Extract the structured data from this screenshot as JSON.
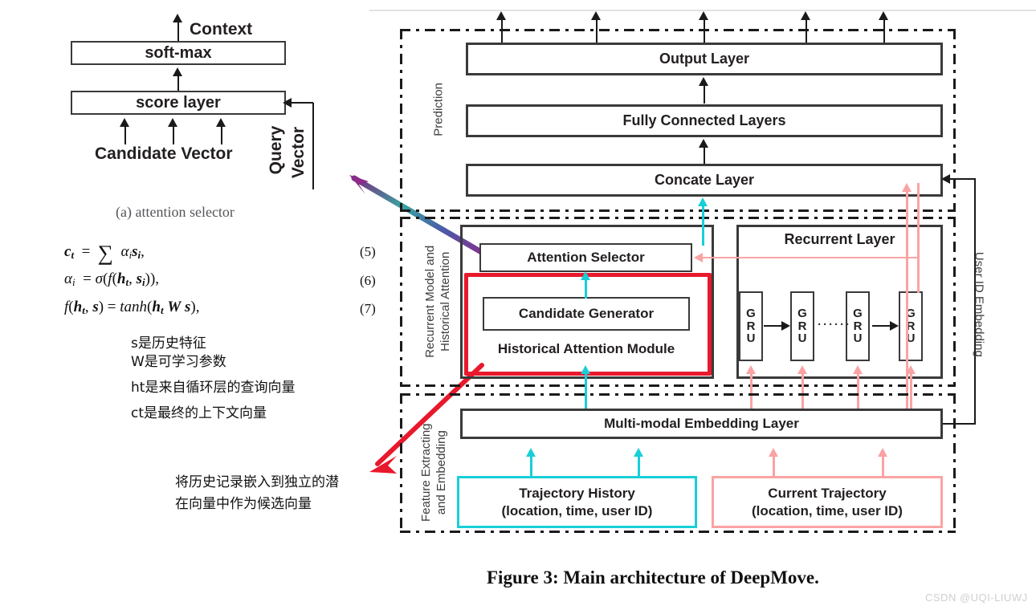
{
  "figure": {
    "caption": "Figure 3: Main architecture of DeepMove.",
    "watermark": "CSDN @UQI-LIUWJ"
  },
  "left_panel": {
    "subcaption": "(a) attention selector",
    "context_label": "Context",
    "softmax_box": "soft-max",
    "score_box": "score layer",
    "candidate_vector_label": "Candidate Vector",
    "query_vector_label_line1": "Query",
    "query_vector_label_line2": "Vector"
  },
  "equations": [
    {
      "text": "ℎ𝑐ₜ = ∑ αᵢsᵢ,",
      "number": "(5)"
    },
    {
      "text": "αᵢ = σ(f(hₜ, sᵢ)),",
      "number": "(6)"
    },
    {
      "text": "f(hₜ, s) = tanh(hₜ W s),",
      "number": "(7)"
    }
  ],
  "equation_render": {
    "eq5_lhs": "c",
    "eq5_sub": "t",
    "eq5_eq": "=",
    "eq5_sum": "∑",
    "eq5_rhs": "α",
    "eq5_rhs_sub": "i",
    "eq5_rhs2": "s",
    "eq5_rhs2_sub": "i",
    "eq5_comma": ",",
    "eq6_full": "αᵢ = σ(f(hₜ, sᵢ)),",
    "eq7_full": "f(hₜ, s) = tanh(hₜ W s),"
  },
  "annotations_cn": {
    "line1": "s是历史特征",
    "line2": "W是可学习参数",
    "line3": "ht是来自循环层的查询向量",
    "line4": "ct是最终的上下文向量",
    "red_note_line1": "将历史记录嵌入到独立的潜",
    "red_note_line2": "在向量中作为候选向量"
  },
  "architecture": {
    "regions": {
      "prediction": "Prediction",
      "recurrent_attention_line1": "Recurrent Model and",
      "recurrent_attention_line2": "Historical Attention",
      "feature_line1": "Feature Extracting",
      "feature_line2": "and Embedding",
      "user_id_embedding": "User ID Embedding"
    },
    "boxes": {
      "output_layer": "Output Layer",
      "fully_connected": "Fully Connected Layers",
      "concate_layer": "Concate Layer",
      "attention_selector": "Attention Selector",
      "candidate_generator": "Candidate Generator",
      "historical_attention_module": "Historical Attention Module",
      "recurrent_layer": "Recurrent Layer",
      "multimodal_embedding": "Multi-modal Embedding Layer"
    },
    "inputs": {
      "trajectory_history_title": "Trajectory History",
      "trajectory_history_sub": "(location, time, user ID)",
      "current_trajectory_title": "Current Trajectory",
      "current_trajectory_sub": "(location, time, user ID)"
    },
    "gru_cells": [
      {
        "l1": "G",
        "l2": "R",
        "l3": "U"
      },
      {
        "l1": "G",
        "l2": "R",
        "l3": "U"
      },
      {
        "l1": "G",
        "l2": "R",
        "l3": "U"
      },
      {
        "l1": "G",
        "l2": "R",
        "l3": "U"
      }
    ],
    "gru_ellipsis": "······"
  },
  "colors": {
    "history_flow": "#18cfd8",
    "current_flow": "#fba3a3",
    "highlight_frame": "#e8192c",
    "ink": "#231f20",
    "region_border": "#1a1a1a",
    "gradient_arrow_from": "#2fa89a",
    "gradient_arrow_to": "#8e2a8b"
  }
}
